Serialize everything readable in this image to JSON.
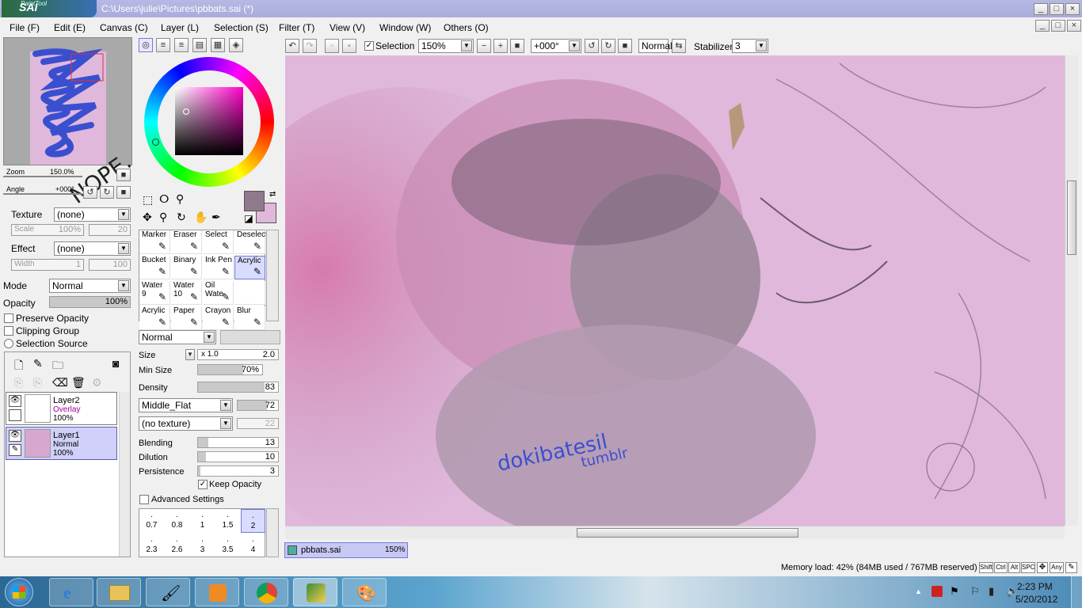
{
  "window": {
    "app_name": "SAI",
    "app_prefix": "PaintTool",
    "title": "C:\\Users\\julie\\Pictures\\pbbats.sai (*)",
    "controls": [
      "_",
      "□",
      "×"
    ]
  },
  "menu": [
    "File (F)",
    "Edit (E)",
    "Canvas (C)",
    "Layer (L)",
    "Selection (S)",
    "Filter (T)",
    "View (V)",
    "Window (W)",
    "Others (O)"
  ],
  "toolbar": {
    "selection_label": "Selection",
    "selection_checked": true,
    "zoom_value": "150%",
    "angle_value": "+000°",
    "blend_mode": "Normal",
    "stabilizer_label": "Stabilizer",
    "stabilizer_value": "3"
  },
  "navigator": {
    "zoom_label": "Zoom",
    "zoom_value": "150.0%",
    "angle_label": "Angle",
    "angle_value": "+000°",
    "scribble_text": "NOPE."
  },
  "texture": {
    "label": "Texture",
    "value": "(none)",
    "scale_label": "Scale",
    "scale_value": "100%",
    "scale_right": "20"
  },
  "effect": {
    "label": "Effect",
    "value": "(none)",
    "width_label": "Width",
    "width_value": "1",
    "width_right": "100"
  },
  "mode": {
    "label": "Mode",
    "value": "Normal"
  },
  "opacity": {
    "label": "Opacity",
    "value": "100%",
    "fraction": 1.0
  },
  "options": {
    "preserve_opacity": "Preserve Opacity",
    "clipping_group": "Clipping Group",
    "selection_source": "Selection Source"
  },
  "layers": [
    {
      "name": "Layer2",
      "mode": "Overlay",
      "opacity": "100%",
      "selected": false
    },
    {
      "name": "Layer1",
      "mode": "Normal",
      "opacity": "100%",
      "selected": true
    }
  ],
  "colors": {
    "primary": "#8f7a8b",
    "secondary": "#e0b8dc",
    "selected_layer_bg": "#d0d0f8",
    "accent": "#7378d8"
  },
  "tools": [
    {
      "name": "Marker",
      "sub": ""
    },
    {
      "name": "Eraser",
      "sub": ""
    },
    {
      "name": "Select",
      "sub": ""
    },
    {
      "name": "Deselect",
      "sub": ""
    },
    {
      "name": "Bucket",
      "sub": ""
    },
    {
      "name": "Binary",
      "sub": ""
    },
    {
      "name": "Ink Pen",
      "sub": ""
    },
    {
      "name": "Acrylic",
      "sub": ""
    },
    {
      "name": "Water",
      "sub": "9"
    },
    {
      "name": "Water",
      "sub": "10"
    },
    {
      "name": "Oil Wate",
      "sub": ""
    },
    {
      "name": "",
      "sub": ""
    },
    {
      "name": "Acrylic",
      "sub": ""
    },
    {
      "name": "Paper",
      "sub": ""
    },
    {
      "name": "Crayon",
      "sub": ""
    },
    {
      "name": "Blur",
      "sub": ""
    }
  ],
  "brush": {
    "blend": "Normal",
    "size_label": "Size",
    "size_mult": "x 1.0",
    "size_value": "2.0",
    "min_size_label": "Min Size",
    "min_size_value": "70%",
    "min_size_fraction": 0.7,
    "density_label": "Density",
    "density_value": "83",
    "density_fraction": 0.83,
    "shape": "Middle_Flat",
    "shape_value": "72",
    "texture": "(no texture)",
    "texture_value": "22",
    "blending_label": "Blending",
    "blending_value": "13",
    "blending_fraction": 0.13,
    "dilution_label": "Dilution",
    "dilution_value": "10",
    "dilution_fraction": 0.1,
    "persistence_label": "Persistence",
    "persistence_value": "3",
    "persistence_fraction": 0.03,
    "keep_opacity": "Keep Opacity",
    "advanced": "Advanced Settings"
  },
  "brush_sizes": [
    "0.7",
    "0.8",
    "1",
    "1.5",
    "2",
    "2.3",
    "2.6",
    "3",
    "3.5",
    "4"
  ],
  "canvas": {
    "watermark_line1": "dokibatesil",
    "watermark_line2": "tumblr"
  },
  "document_tab": {
    "name": "pbbats.sai",
    "zoom": "150%"
  },
  "status": {
    "memory": "Memory load: 42% (84MB used / 767MB reserved)",
    "keys": [
      "Shift",
      "Ctrl",
      "Alt",
      "SPC",
      "Any"
    ]
  },
  "taskbar": {
    "time": "2:23 PM",
    "date": "5/20/2012"
  }
}
